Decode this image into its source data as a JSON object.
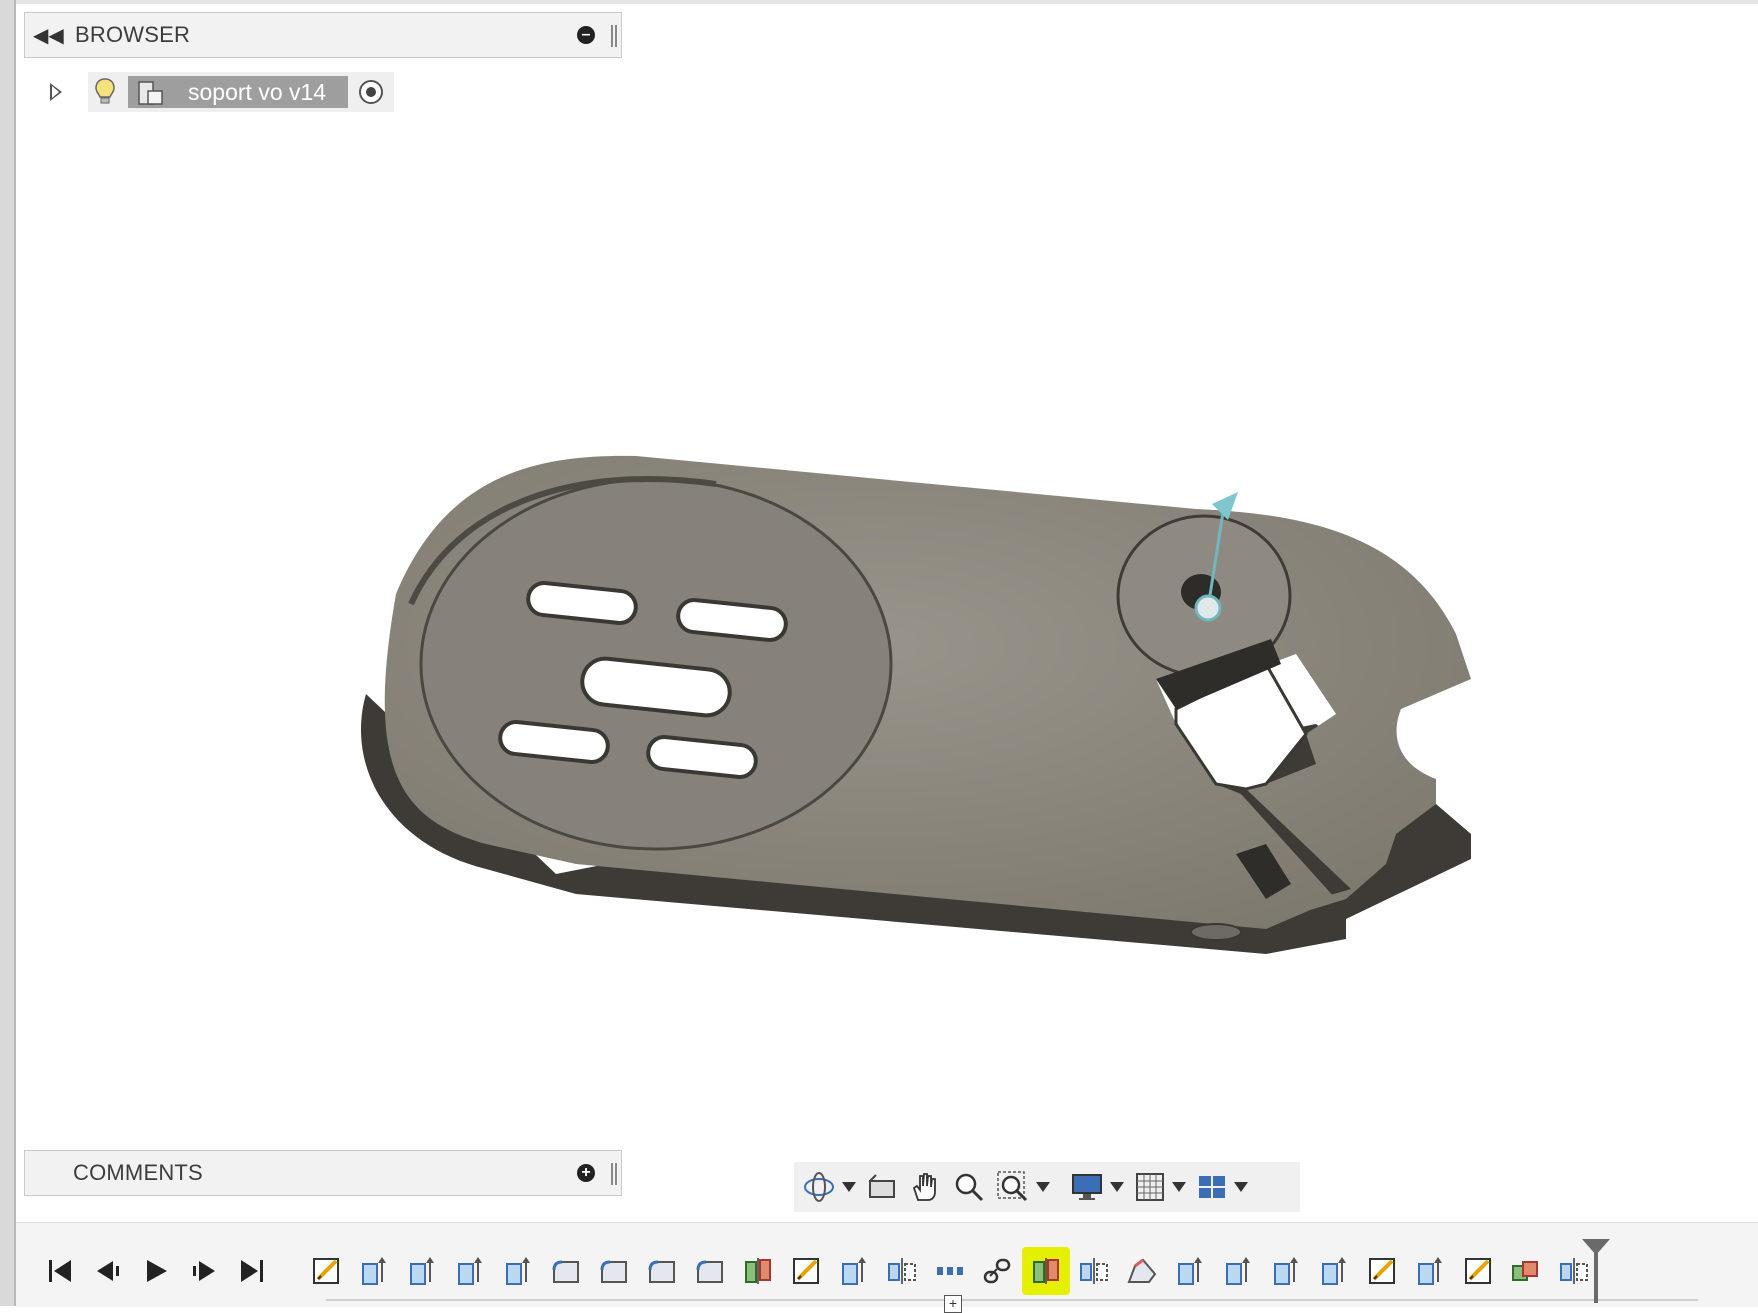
{
  "browser": {
    "title": "BROWSER"
  },
  "tree": {
    "root": {
      "name": "soport vo v14"
    }
  },
  "comments": {
    "title": "COMMENTS"
  },
  "nav_toolbar": {
    "icons": [
      "orbit-icon",
      "look-at-icon",
      "pan-hand-icon",
      "zoom-icon",
      "fit-zoom-icon",
      "display-settings-icon",
      "grid-icon",
      "viewports-icon"
    ]
  },
  "timeline": {
    "controls": [
      "skip-to-start",
      "step-back",
      "play",
      "step-forward",
      "skip-to-end"
    ],
    "features": [
      "sketch",
      "extrude",
      "extrude",
      "extrude",
      "extrude",
      "fillet",
      "fillet",
      "fillet",
      "fillet",
      "split-body",
      "sketch",
      "extrude",
      "mirror",
      "pattern",
      "joint",
      "split-body",
      "mirror",
      "chamfer",
      "extrude",
      "extrude",
      "extrude",
      "extrude",
      "sketch",
      "extrude",
      "sketch",
      "combine",
      "mirror"
    ],
    "active_feature_index": 15
  },
  "colors": {
    "body": "#8a857c",
    "highlight": "#e5f000",
    "panel": "#f2f2f2"
  }
}
